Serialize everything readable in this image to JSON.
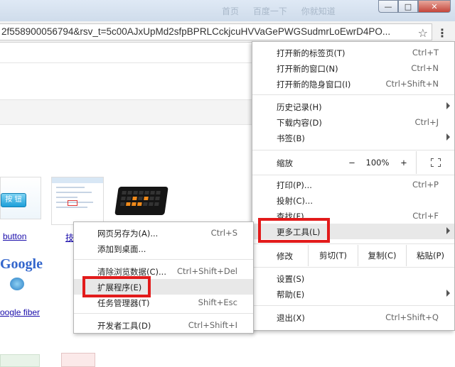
{
  "window": {
    "title_faded": [
      "首页",
      "百度一下",
      "你就知道"
    ],
    "minimize_glyph": "—",
    "maximize_glyph": "□",
    "close_glyph": "✕"
  },
  "addressbar": {
    "url": "2f558900056794&rsv_t=5c00AJxUpMd2sfpBPRLCckjcuHVVaGePWGSudmrLoEwrD4PO...",
    "star_glyph": "☆",
    "menu_glyph": "⋮"
  },
  "page": {
    "thumb_button_label": "按 钮",
    "link_button": "button",
    "link_partial": "技",
    "google_word": "Google",
    "link_google_fiber": "oogle fiber"
  },
  "menu": {
    "new_tab": {
      "label": "打开新的标签页(T)",
      "shortcut": "Ctrl+T"
    },
    "new_window": {
      "label": "打开新的窗口(N)",
      "shortcut": "Ctrl+N"
    },
    "new_incognito": {
      "label": "打开新的隐身窗口(I)",
      "shortcut": "Ctrl+Shift+N"
    },
    "history": {
      "label": "历史记录(H)"
    },
    "downloads": {
      "label": "下载内容(D)",
      "shortcut": "Ctrl+J"
    },
    "bookmarks": {
      "label": "书签(B)"
    },
    "zoom": {
      "label": "缩放",
      "minus": "−",
      "value": "100%",
      "plus": "+"
    },
    "print": {
      "label": "打印(P)...",
      "shortcut": "Ctrl+P"
    },
    "cast": {
      "label": "投射(C)..."
    },
    "find": {
      "label": "查找(F)...",
      "shortcut": "Ctrl+F"
    },
    "more_tools": {
      "label": "更多工具(L)"
    },
    "edit": {
      "label": "修改",
      "cut": "剪切(T)",
      "copy": "复制(C)",
      "paste": "粘贴(P)"
    },
    "settings": {
      "label": "设置(S)"
    },
    "help": {
      "label": "帮助(E)"
    },
    "exit": {
      "label": "退出(X)",
      "shortcut": "Ctrl+Shift+Q"
    }
  },
  "submenu": {
    "save_page": {
      "label": "网页另存为(A)...",
      "shortcut": "Ctrl+S"
    },
    "add_desktop": {
      "label": "添加到桌面..."
    },
    "clear_data": {
      "label": "清除浏览数据(C)...",
      "shortcut": "Ctrl+Shift+Del"
    },
    "extensions": {
      "label": "扩展程序(E)"
    },
    "task_manager": {
      "label": "任务管理器(T)",
      "shortcut": "Shift+Esc"
    },
    "dev_tools": {
      "label": "开发者工具(D)",
      "shortcut": "Ctrl+Shift+I"
    }
  },
  "colors": {
    "highlight_box": "#e21b1b",
    "menu_hover": "#e8e8e8",
    "link": "#1a0dab"
  }
}
